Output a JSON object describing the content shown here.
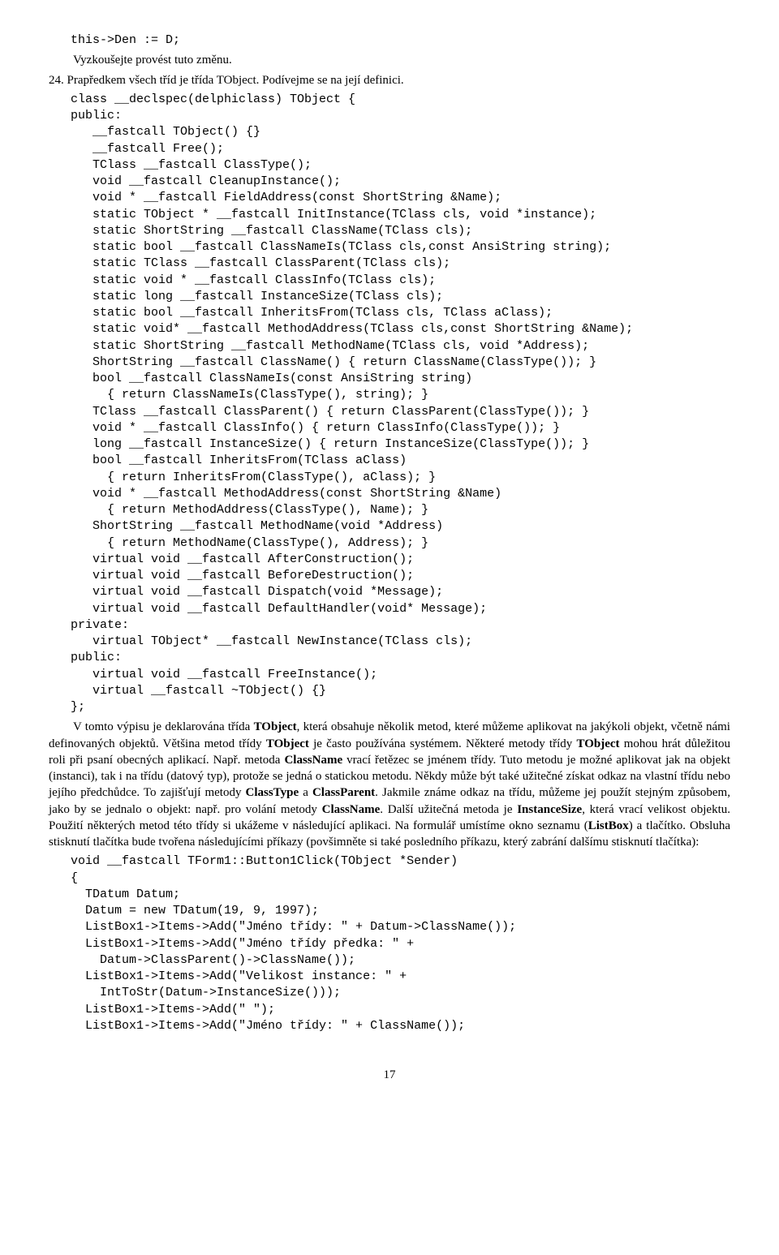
{
  "code_top": "   this->Den := D;",
  "prose1": "Vyzkoušejte provést tuto změnu.",
  "prose2_prefix": "24.",
  "prose2_rest": " Prapředkem všech tříd je třída TObject. Podívejme se na její definici.",
  "code_class": "   class __declspec(delphiclass) TObject {\n   public:\n      __fastcall TObject() {}\n      __fastcall Free();\n      TClass __fastcall ClassType();\n      void __fastcall CleanupInstance();\n      void * __fastcall FieldAddress(const ShortString &Name);\n      static TObject * __fastcall InitInstance(TClass cls, void *instance);\n      static ShortString __fastcall ClassName(TClass cls);\n      static bool __fastcall ClassNameIs(TClass cls,const AnsiString string);\n      static TClass __fastcall ClassParent(TClass cls);\n      static void * __fastcall ClassInfo(TClass cls);\n      static long __fastcall InstanceSize(TClass cls);\n      static bool __fastcall InheritsFrom(TClass cls, TClass aClass);\n      static void* __fastcall MethodAddress(TClass cls,const ShortString &Name);\n      static ShortString __fastcall MethodName(TClass cls, void *Address);\n      ShortString __fastcall ClassName() { return ClassName(ClassType()); }\n      bool __fastcall ClassNameIs(const AnsiString string)\n        { return ClassNameIs(ClassType(), string); }\n      TClass __fastcall ClassParent() { return ClassParent(ClassType()); }\n      void * __fastcall ClassInfo() { return ClassInfo(ClassType()); }\n      long __fastcall InstanceSize() { return InstanceSize(ClassType()); }\n      bool __fastcall InheritsFrom(TClass aClass)\n        { return InheritsFrom(ClassType(), aClass); }\n      void * __fastcall MethodAddress(const ShortString &Name)\n        { return MethodAddress(ClassType(), Name); }\n      ShortString __fastcall MethodName(void *Address)\n        { return MethodName(ClassType(), Address); }\n      virtual void __fastcall AfterConstruction();\n      virtual void __fastcall BeforeDestruction();\n      virtual void __fastcall Dispatch(void *Message);\n      virtual void __fastcall DefaultHandler(void* Message);\n   private:\n      virtual TObject* __fastcall NewInstance(TClass cls);\n   public:\n      virtual void __fastcall FreeInstance();\n      virtual __fastcall ~TObject() {}\n   };",
  "prose3_parts": [
    "V tomto výpisu je deklarována třída ",
    "TObject",
    ", která obsahuje několik metod, které můžeme aplikovat na jakýkoli objekt, včetně námi definovaných objektů. Většina metod třídy ",
    "TObject",
    " je často používána systémem. Některé metody třídy ",
    "TObject",
    " mohou hrát důležitou roli při psaní obecných aplikací. Např. metoda ",
    "ClassName",
    " vrací řetězec se jménem třídy. Tuto metodu je možné aplikovat jak na objekt (instanci), tak i na třídu (datový typ), protože se jedná o statickou metodu. Někdy může být také užitečné získat odkaz na vlastní třídu nebo jejího předchůdce. To zajišťují metody ",
    "ClassType",
    " a ",
    "ClassParent",
    ". Jakmile známe odkaz na třídu, můžeme jej použít stejným způsobem, jako by se jednalo o objekt: např. pro volání metody ",
    "ClassName",
    ". Další užitečná metoda je ",
    "InstanceSize",
    ", která vrací velikost objektu. Použití některých metod této třídy si ukážeme v následující aplikaci. Na formulář umístíme okno seznamu (",
    "ListBox",
    ") a tlačítko. Obsluha stisknutí tlačítka bude tvořena následujícími příkazy (povšimněte si také posledního příkazu, který zabrání dalšímu stisknutí tlačítka):"
  ],
  "code_bottom": "   void __fastcall TForm1::Button1Click(TObject *Sender)\n   {\n     TDatum Datum;\n     Datum = new TDatum(19, 9, 1997);\n     ListBox1->Items->Add(\"Jméno třídy: \" + Datum->ClassName());\n     ListBox1->Items->Add(\"Jméno třídy předka: \" +\n       Datum->ClassParent()->ClassName());\n     ListBox1->Items->Add(\"Velikost instance: \" +\n       IntToStr(Datum->InstanceSize()));\n     ListBox1->Items->Add(\" \");\n     ListBox1->Items->Add(\"Jméno třídy: \" + ClassName());",
  "page_number": "17"
}
